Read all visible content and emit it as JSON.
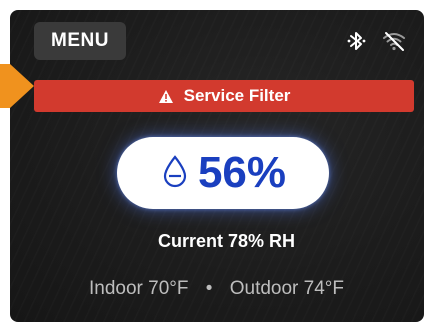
{
  "menu": {
    "label": "MENU"
  },
  "status": {
    "icons": [
      "bluetooth-icon",
      "wifi-off-icon"
    ]
  },
  "alert": {
    "icon": "warning-icon",
    "text": "Service Filter",
    "color": "#d23a2e"
  },
  "humidity": {
    "icon": "droplet-icon",
    "value": "56%",
    "accent": "#1a3fbf"
  },
  "current": {
    "text": "Current 78% RH"
  },
  "temperatures": {
    "indoor": "Indoor 70°F",
    "separator": "•",
    "outdoor": "Outdoor 74°F"
  },
  "callout": {
    "color": "#f0921e"
  }
}
